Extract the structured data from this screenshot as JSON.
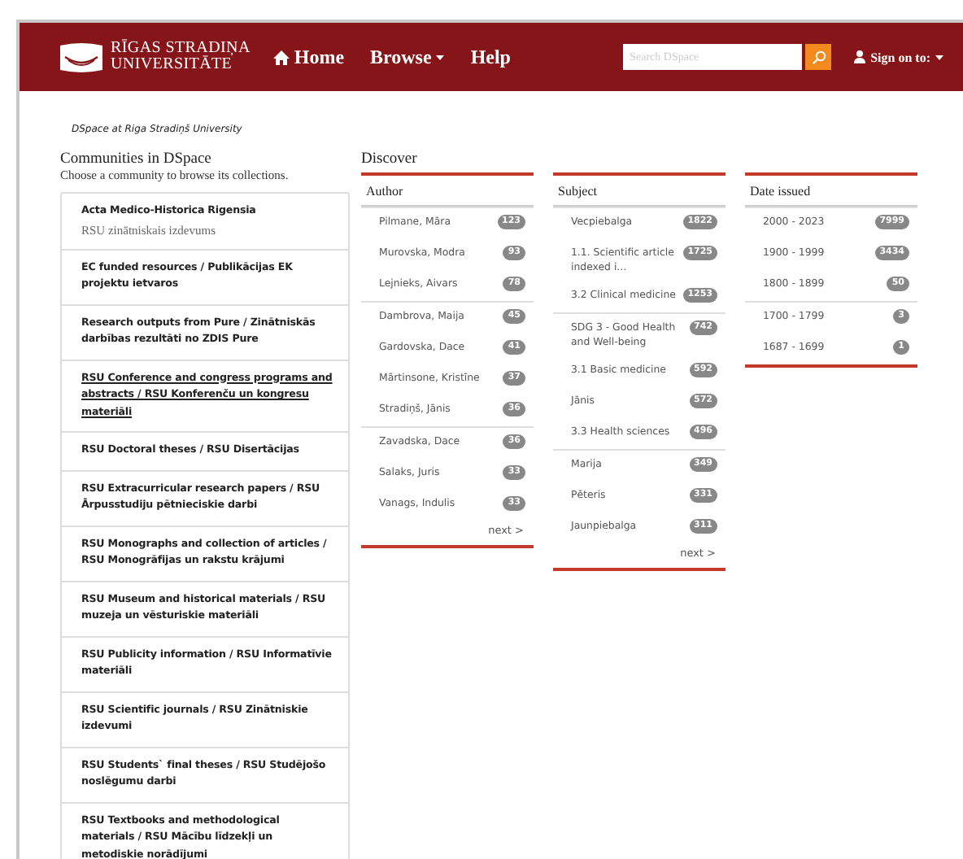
{
  "header": {
    "logo_lines": [
      "RĪGAS STRADIŅA",
      "UNIVERSITĀTE"
    ],
    "nav": [
      {
        "label": "Home",
        "kind": "home"
      },
      {
        "label": "Browse",
        "caret": true
      },
      {
        "label": "Help"
      }
    ],
    "search": {
      "placeholder": "Search DSpace"
    },
    "sign_on": "Sign on to:"
  },
  "breadcrumb": "DSpace at Riga Stradiņš University",
  "communities": {
    "title": "Communities in DSpace",
    "subtitle": "Choose a community to browse its collections.",
    "items": [
      {
        "name": "Acta Medico-Historica Rigensia",
        "description": "RSU zinātniskais izdevums",
        "hovered": false
      },
      {
        "name": "EC funded resources / Publikācijas EK projektu ietvaros",
        "hovered": false
      },
      {
        "name": "Research outputs from Pure / Zinātniskās darbības rezultāti no ZDIS Pure",
        "hovered": false
      },
      {
        "name": "RSU Conference and congress programs and abstracts / RSU Konferenču un kongresu materiāli",
        "hovered": true
      },
      {
        "name": "RSU Doctoral theses / RSU Disertācijas",
        "hovered": false
      },
      {
        "name": "RSU Extracurricular research papers / RSU Ārpusstudiju pētnieciskie darbi",
        "hovered": false
      },
      {
        "name": "RSU Monographs and collection of articles / RSU Monogrāfijas un rakstu krājumi",
        "hovered": false
      },
      {
        "name": "RSU Museum and historical materials / RSU muzeja un vēsturiskie materiāli",
        "hovered": false
      },
      {
        "name": "RSU Publicity information / RSU Informatīvie materiāli",
        "hovered": false
      },
      {
        "name": "RSU Scientific journals / RSU Zinātniskie izdevumi",
        "hovered": false
      },
      {
        "name": "RSU Students` final theses / RSU Studējošo noslēgumu darbi",
        "hovered": false
      },
      {
        "name": "RSU Textbooks and methodological materials / RSU Mācību līdzekļi un metodiskie norādījumi",
        "hovered": false
      }
    ]
  },
  "discover": {
    "title": "Discover",
    "facets": [
      {
        "title": "Author",
        "next": "next >",
        "groups": [
          [
            {
              "label": "Pilmane, Māra",
              "count": "123"
            },
            {
              "label": "Murovska, Modra",
              "count": "93"
            },
            {
              "label": "Lejnieks, Aivars",
              "count": "78"
            }
          ],
          [
            {
              "label": "Dambrova, Maija",
              "count": "45"
            },
            {
              "label": "Gardovska, Dace",
              "count": "41"
            },
            {
              "label": "Mārtinsone, Kristīne",
              "count": "37"
            },
            {
              "label": "Stradiņš, Jānis",
              "count": "36"
            }
          ],
          [
            {
              "label": "Zavadska, Dace",
              "count": "36"
            },
            {
              "label": "Salaks, Juris",
              "count": "33"
            },
            {
              "label": "Vanags, Indulis",
              "count": "33"
            }
          ]
        ]
      },
      {
        "title": "Subject",
        "next": "next >",
        "groups": [
          [
            {
              "label": "Vecpiebalga",
              "count": "1822"
            },
            {
              "label": "1.1. Scientific article indexed i...",
              "count": "1725"
            },
            {
              "label": "3.2 Clinical medicine",
              "count": "1253"
            }
          ],
          [
            {
              "label": "SDG 3 - Good Health and Well-being",
              "count": "742"
            },
            {
              "label": "3.1 Basic medicine",
              "count": "592"
            },
            {
              "label": "Jānis",
              "count": "572"
            },
            {
              "label": "3.3 Health sciences",
              "count": "496"
            }
          ],
          [
            {
              "label": "Marija",
              "count": "349"
            },
            {
              "label": "Pēteris",
              "count": "331"
            },
            {
              "label": "Jaunpiebalga",
              "count": "311"
            }
          ]
        ]
      },
      {
        "title": "Date issued",
        "groups": [
          [
            {
              "label": "2000 - 2023",
              "count": "7999"
            },
            {
              "label": "1900 - 1999",
              "count": "3434"
            },
            {
              "label": "1800 - 1899",
              "count": "50"
            }
          ],
          [
            {
              "label": "1700 - 1799",
              "count": "3"
            },
            {
              "label": "1687 - 1699",
              "count": "1"
            }
          ]
        ]
      }
    ]
  }
}
